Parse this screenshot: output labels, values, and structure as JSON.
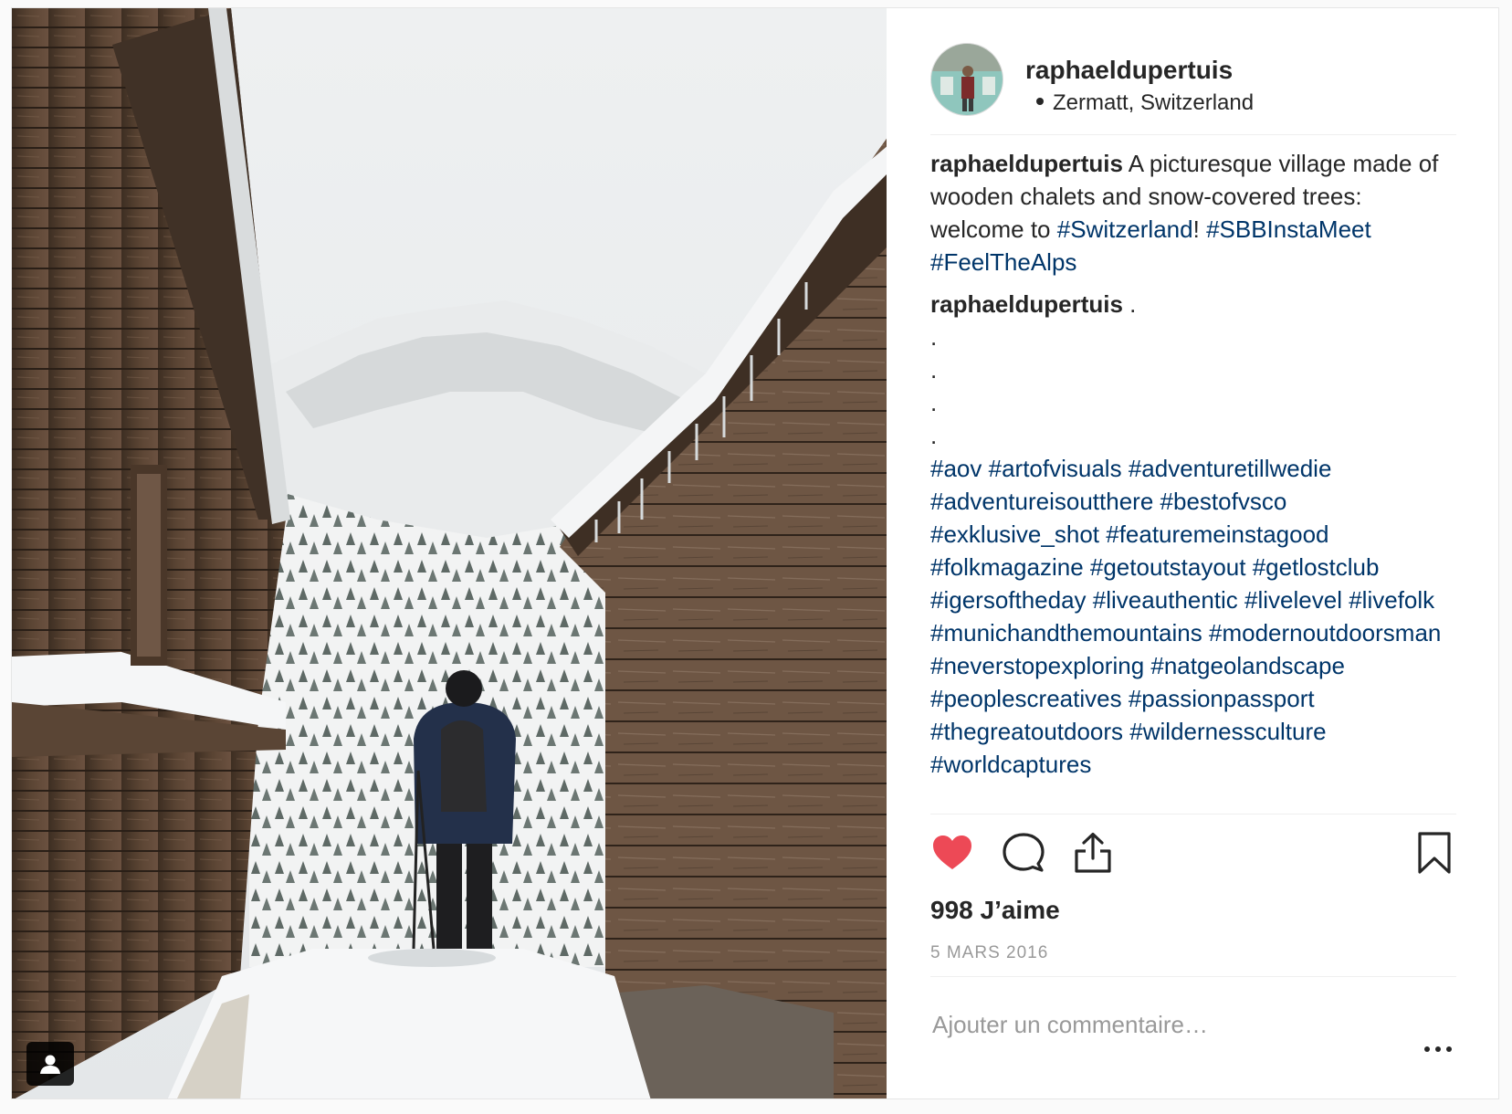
{
  "post": {
    "owner": "raphaeldupertuis",
    "location": "Zermatt, Switzerland",
    "caption_user": "raphaeldupertuis",
    "caption_text_1": "A picturesque village made of wooden chalets and snow-covered trees: welcome to ",
    "caption_tag_switzerland": "#Switzerland",
    "caption_text_2": "!",
    "caption_tag_sbb": "#SBBInstaMeet",
    "caption_tag_alps": "#FeelTheAlps",
    "comment_user": "raphaeldupertuis",
    "comment_first": ".",
    "comment_dots": [
      ".",
      ".",
      ".",
      "."
    ],
    "hashtags": [
      "#aov",
      "#artofvisuals",
      "#adventuretillwedie",
      "#adventureisoutthere",
      "#bestofvsco",
      "#exklusive_shot",
      "#featuremeinstagood",
      "#folkmagazine",
      "#getoutstayout",
      "#getlostclub",
      "#igersoftheday",
      "#liveauthentic",
      "#livelevel",
      "#livefolk",
      "#munichandthemountains",
      "#modernoutdoorsman",
      "#neverstopexploring",
      "#natgeolandscape",
      "#peoplescreatives",
      "#passionpassport",
      "#thegreatoutdoors",
      "#wildernessculture",
      "#worldcaptures"
    ],
    "likes": "998 J’aime",
    "date": "5 MARS 2016",
    "comment_placeholder": "Ajouter un commentaire…"
  },
  "icons": {
    "like": "heart-icon",
    "comment": "speech-bubble-icon",
    "share": "share-icon",
    "save": "bookmark-icon",
    "more": "more-dots-icon",
    "tagged_user": "user-icon"
  },
  "colors": {
    "liked_heart": "#ed4956",
    "hashtag": "#003569",
    "secondary_text": "#999999"
  }
}
